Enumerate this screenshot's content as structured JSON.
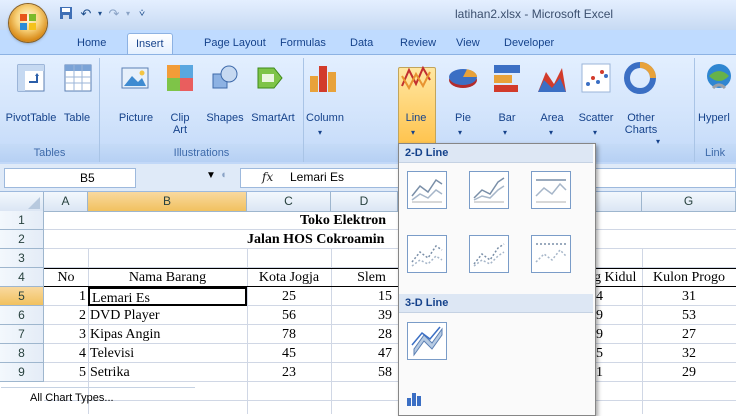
{
  "window": {
    "title": "latihan2.xlsx - Microsoft Excel"
  },
  "tabs": [
    "Home",
    "Insert",
    "Page Layout",
    "Formulas",
    "Data",
    "Review",
    "View",
    "Developer"
  ],
  "ribbon": {
    "buttons": {
      "pivot": "PivotTable",
      "table": "Table",
      "picture": "Picture",
      "clip": "Clip",
      "clip2": "Art",
      "shapes": "Shapes",
      "smartart": "SmartArt",
      "column": "Column",
      "line": "Line",
      "pie": "Pie",
      "bar": "Bar",
      "area": "Area",
      "scatter": "Scatter",
      "other": "Other",
      "other2": "Charts",
      "hyper": "Hyperl"
    },
    "groups": {
      "tables": "Tables",
      "illustrations": "Illustrations",
      "links": "Link"
    }
  },
  "formula": {
    "namebox": "B5",
    "fx": "fx",
    "content": "Lemari Es"
  },
  "grid": {
    "columns": [
      "A",
      "B",
      "C",
      "D",
      "G"
    ],
    "rows": [
      "1",
      "2",
      "3",
      "4",
      "5",
      "6",
      "7",
      "8",
      "9"
    ],
    "title1": "Toko Elektron",
    "title2": "Jalan HOS Cokroamin",
    "headers": {
      "no": "No",
      "nama": "Nama Barang",
      "jogja": "Kota Jogja",
      "sleman": "Slem",
      "gk": "g Kidul",
      "kp": "Kulon Progo"
    },
    "data": [
      {
        "no": "1",
        "nama": "Lemari Es",
        "jogja": "25",
        "sleman": "15",
        "gk": "4",
        "kp": "31"
      },
      {
        "no": "2",
        "nama": "DVD Player",
        "jogja": "56",
        "sleman": "39",
        "gk": "9",
        "kp": "53"
      },
      {
        "no": "3",
        "nama": "Kipas Angin",
        "jogja": "78",
        "sleman": "28",
        "gk": "9",
        "kp": "27"
      },
      {
        "no": "4",
        "nama": "Televisi",
        "jogja": "45",
        "sleman": "47",
        "gk": "5",
        "kp": "32"
      },
      {
        "no": "5",
        "nama": "Setrika",
        "jogja": "23",
        "sleman": "58",
        "gk": "1",
        "kp": "29"
      }
    ]
  },
  "dropdown": {
    "head2d": "2-D Line",
    "head3d": "3-D Line",
    "footer": "All Chart Types..."
  }
}
